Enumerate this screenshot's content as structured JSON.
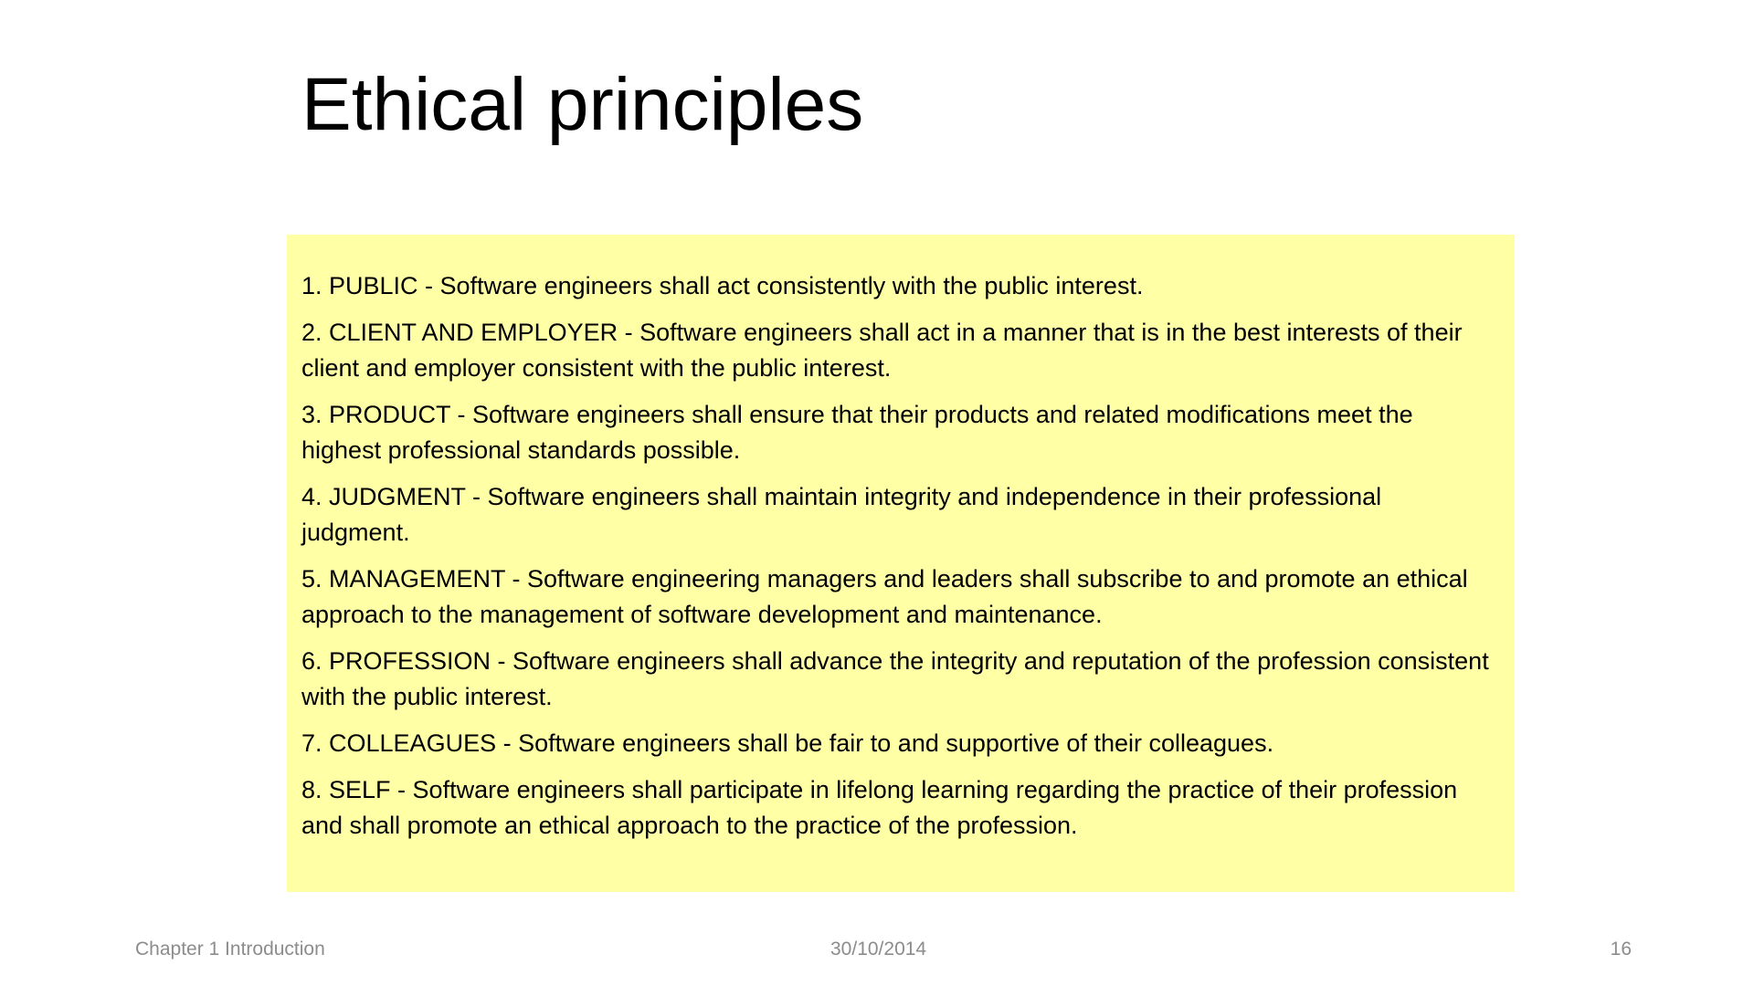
{
  "slide": {
    "title": "Ethical principles",
    "background": "#ffffff",
    "box_color": "#ffffa6"
  },
  "principles": [
    "1. PUBLIC - Software engineers shall act consistently with the public interest.",
    "2. CLIENT AND EMPLOYER - Software engineers shall act in a manner that is in the best interests of their client and employer consistent with the public interest.",
    "3. PRODUCT - Software engineers shall ensure that their products and related modifications meet the highest professional standards possible.",
    "4. JUDGMENT - Software engineers shall maintain integrity and independence in their professional judgment.",
    "5. MANAGEMENT - Software engineering managers and leaders shall subscribe to and promote an ethical approach to the management of software development and maintenance.",
    "6. PROFESSION - Software engineers shall advance the integrity and reputation of the profession consistent with the public interest.",
    "7. COLLEAGUES - Software engineers shall be fair to and supportive of their colleagues.",
    "8. SELF - Software engineers shall participate in lifelong learning regarding the practice of their profession and shall promote an ethical approach to the practice of the profession."
  ],
  "footer": {
    "chapter": "Chapter 1 Introduction",
    "date": "30/10/2014",
    "page_number": "16"
  }
}
